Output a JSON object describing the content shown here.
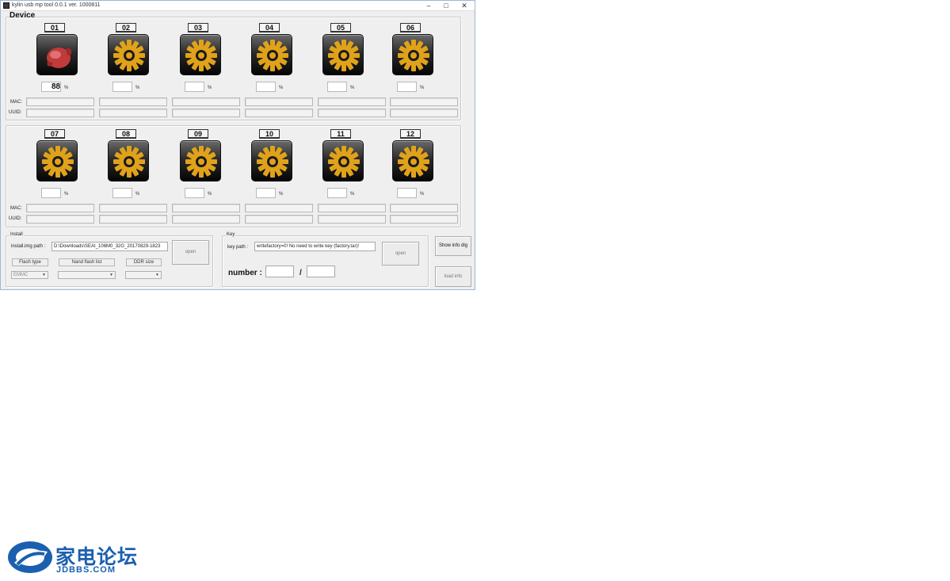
{
  "window": {
    "title": "kylin usb mp tool 0.0.1  ver. 1000811",
    "minimize_glyph": "–",
    "maximize_glyph": "□",
    "close_glyph": "✕"
  },
  "device": {
    "title": "Device",
    "mac_label": "MAC:",
    "uuid_label": "UUID:",
    "slots": [
      {
        "number": "01",
        "progress_text": "88",
        "percent_sign": "%",
        "icon": "burn-active-icon"
      },
      {
        "number": "02",
        "progress_text": "",
        "percent_sign": "%",
        "icon": "gear-icon"
      },
      {
        "number": "03",
        "progress_text": "",
        "percent_sign": "%",
        "icon": "gear-icon"
      },
      {
        "number": "04",
        "progress_text": "",
        "percent_sign": "%",
        "icon": "gear-icon"
      },
      {
        "number": "05",
        "progress_text": "",
        "percent_sign": "%",
        "icon": "gear-icon"
      },
      {
        "number": "06",
        "progress_text": "",
        "percent_sign": "%",
        "icon": "gear-icon"
      },
      {
        "number": "07",
        "progress_text": "",
        "percent_sign": "%",
        "icon": "gear-icon"
      },
      {
        "number": "08",
        "progress_text": "",
        "percent_sign": "%",
        "icon": "gear-icon"
      },
      {
        "number": "09",
        "progress_text": "",
        "percent_sign": "%",
        "icon": "gear-icon"
      },
      {
        "number": "10",
        "progress_text": "",
        "percent_sign": "%",
        "icon": "gear-icon"
      },
      {
        "number": "11",
        "progress_text": "",
        "percent_sign": "%",
        "icon": "gear-icon"
      },
      {
        "number": "12",
        "progress_text": "",
        "percent_sign": "%",
        "icon": "gear-icon"
      }
    ]
  },
  "install": {
    "title": "Install",
    "img_path_label": "install.img path :",
    "img_path_value": "D:\\Downloads\\SEAI_106M0_32G_20170829-1823",
    "open_button": "open",
    "flash_type_label": "Flash type",
    "nand_flash_label": "Nand flash list",
    "ddr_size_label": "DDR size",
    "flash_type_value": "EMMC",
    "nand_flash_value": "",
    "ddr_size_value": ""
  },
  "key": {
    "title": "Key",
    "key_path_label": "key path :",
    "key_path_value": "writefactory=0! No need to write key (factory.tar)!",
    "open_button": "open",
    "number_label": "number :",
    "number_separator": "/",
    "number_current": "",
    "number_total": ""
  },
  "side_buttons": {
    "show_info_label": "Show info dlg",
    "load_info_label": "load info"
  },
  "watermark": {
    "chinese_text": "家电论坛",
    "site_text": "JDBBS.COM"
  },
  "colors": {
    "window_bg": "#efefef",
    "gear_gold": "#e0a21a",
    "active_red": "#c23a3a",
    "watermark_blue": "#1b5fb0"
  }
}
